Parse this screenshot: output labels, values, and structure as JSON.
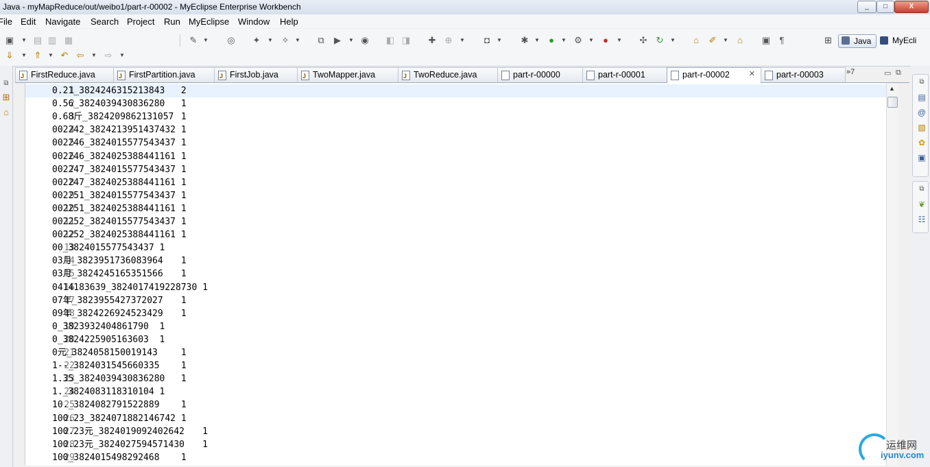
{
  "window": {
    "title": "Java - myMapReduce/out/weibo1/part-r-00002 - MyEclipse Enterprise Workbench",
    "controls": [
      "_",
      "□",
      "X"
    ]
  },
  "menu": [
    "File",
    "Edit",
    "Navigate",
    "Search",
    "Project",
    "Run",
    "MyEclipse",
    "Window",
    "Help"
  ],
  "perspectives": {
    "open_icon": "open-perspective-icon",
    "java": "Java",
    "myeclipse": "MyEcli"
  },
  "tabs": [
    {
      "label": "FirstReduce.java",
      "type": "java"
    },
    {
      "label": "FirstPartition.java",
      "type": "java"
    },
    {
      "label": "FirstJob.java",
      "type": "java"
    },
    {
      "label": "TwoMapper.java",
      "type": "java"
    },
    {
      "label": "TwoReduce.java",
      "type": "java"
    },
    {
      "label": "part-r-00000",
      "type": "file"
    },
    {
      "label": "part-r-00001",
      "type": "file"
    },
    {
      "label": "part-r-00002",
      "type": "file",
      "active": true,
      "close": "✕"
    },
    {
      "label": "part-r-00003",
      "type": "file"
    }
  ],
  "tab_overflow": "»7",
  "editor": {
    "lines": [
      "0.21_3824246315213843\t2",
      "0.56_3824039430836280\t1",
      "0.68斤_3824209862131057\t1",
      "002242_3824213951437432\t1",
      "002246_3824015577543437\t1",
      "002246_3824025388441161\t1",
      "002247_3824015577543437\t1",
      "002247_3824025388441161\t1",
      "002251_3824015577543437\t1",
      "002251_3824025388441161\t1",
      "002252_3824015577543437\t1",
      "002252_3824025388441161\t1",
      "00_3824015577543437\t1",
      "03月_3823951736083964\t1",
      "03月_3824245165351566\t1",
      "0414183639_3824017419228730\t1",
      "07年_3823955427372027\t1",
      "09年_3824226924523429\t1",
      "0_3823932404861790\t1",
      "0_3824225905163603\t1",
      "0元_3824058150019143\t1",
      "1--_3824031545660335\t1",
      "1.35_3824039430836280\t1",
      "1._3824083118310104\t1",
      "10._3824082791522889\t1",
      "100.23_3824071882146742\t1",
      "100.23元_3824019092402642\t1",
      "100.23元_3824027594571430\t1",
      "100_3824015498292468\t1"
    ]
  },
  "watermark": {
    "cn": "运维网",
    "en": "iyunv.com"
  }
}
